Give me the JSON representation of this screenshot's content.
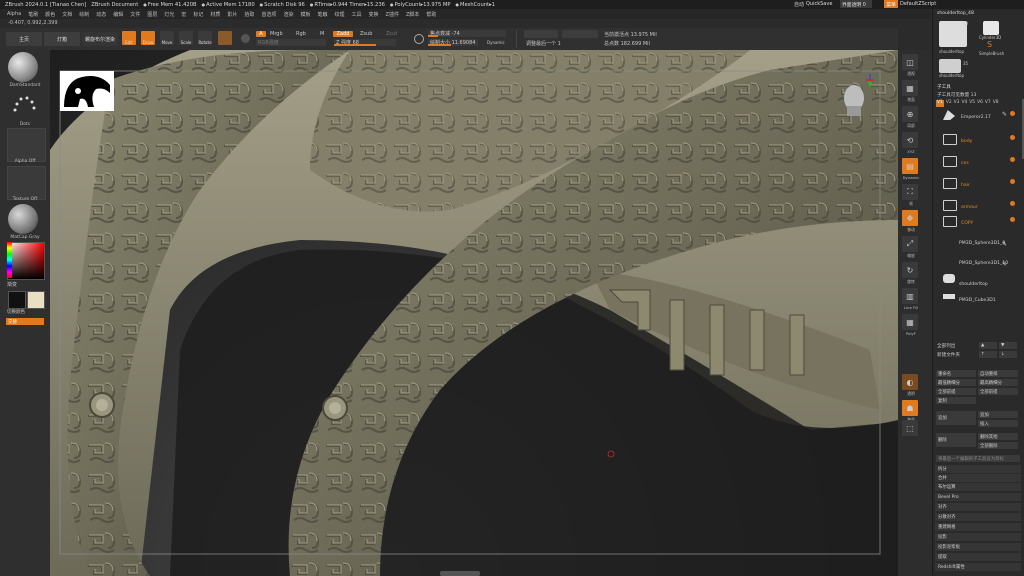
{
  "titlebar": {
    "items": [
      "ZBrush 2024.0.1 [Tianao Chen]",
      "ZBrush Document",
      "Free Mem 41.420B",
      "Active Mem 17180",
      "Scratch Disk 96",
      "RTime▸0.944 Timer▸15.236",
      "PolyCount▸13.975 MP",
      "MeshCount▸1"
    ],
    "quicksave": "QuickSave",
    "autosave": "自动",
    "transparency": "界面透明 0",
    "menu_label": "菜单",
    "script": "DefaultZScript"
  },
  "menubar": [
    "Alpha",
    "笔刷",
    "颜色",
    "文档",
    "绘制",
    "动态",
    "编辑",
    "文件",
    "图层",
    "灯光",
    "宏",
    "标记",
    "材质",
    "影片",
    "拾取",
    "首选项",
    "渲染",
    "模板",
    "笔触",
    "纹理",
    "工具",
    "变换",
    "Z插件",
    "Z脚本",
    "帮助"
  ],
  "coords": "-0.407, 0.992,2.399",
  "toolbar": {
    "home": "主页",
    "lightbox": "灯箱",
    "live_boolean": "螺旋布尔渲染",
    "edit": "Edit",
    "draw": "Draw",
    "move": "Move",
    "scale": "Scale",
    "rotate": "Rotate",
    "a_label": "A",
    "mrgb": "Mrgb",
    "rgb": "Rgb",
    "m": "M",
    "zadd": "Zadd",
    "zsub": "Zsub",
    "zcut": "Zcut",
    "rgb_intensity": "RGB强度",
    "z_intensity": "Z 强度 68",
    "focal_shift": "焦点衰减 -74",
    "draw_size": "绘制大小 11.69084",
    "dynamic": "Dynamic",
    "active_points": "当前激活点 13.975 Mil",
    "total_points": "总点数 182.699 Mil",
    "adjust_last": "调整最后一个 1",
    "draw_size_value": 11.69084,
    "z_intensity_value": 68,
    "focal_shift_value": -74
  },
  "leftshelf": {
    "brush": "DamStandard",
    "stroke": "Dots",
    "alpha": "Alpha Off",
    "texture": "Texture Off",
    "material": "MatCap Gray",
    "gradient": "渐变",
    "switch_color": "切换颜色",
    "alternate": "交替"
  },
  "righttray": [
    "透视",
    "地面",
    "局部",
    "XYZ",
    "Dynamic",
    "帧",
    "移动",
    "缩放",
    "旋转",
    "Line Fill",
    "PolyF",
    "透明",
    "独显"
  ],
  "panel": {
    "tool_name": "shoulderltop_48",
    "thumb1_label": "shoulderltop",
    "thumb1_count": "73",
    "thumb2_label": "Cylinder3D",
    "thumb3_label": "SimpleBrush",
    "thumb4_label": "shoulderltop",
    "thumb4_count": "35",
    "section_title": "子工具",
    "visible_count": "子工具可见数量 13",
    "tabs": [
      "V1",
      "V2",
      "V3",
      "V4",
      "V5",
      "V6",
      "V7",
      "V8"
    ],
    "subtools": [
      {
        "name": "Emperor2.17",
        "type": "mesh"
      },
      {
        "name": "body",
        "type": "folder"
      },
      {
        "name": "cos",
        "type": "folder"
      },
      {
        "name": "hair",
        "type": "folder"
      },
      {
        "name": "armour",
        "type": "folder"
      },
      {
        "name": "COPY",
        "type": "folder"
      },
      {
        "name": "PM3D_Sphere3D1_9",
        "type": "mesh"
      },
      {
        "name": "PM3D_Sphere3D1_10",
        "type": "mesh"
      },
      {
        "name": "shoulderltop",
        "type": "mesh"
      },
      {
        "name": "PM3D_Cube3D1",
        "type": "mesh"
      }
    ],
    "list_all": "全部列出",
    "new_folder": "新建文件夹",
    "rename": "重命名",
    "auto_reorder": "自动重排",
    "all_low": "最低精细分",
    "all_high": "最高精细分",
    "copy": "复制",
    "duplicate": "全部前提",
    "mirror_all": "全部前提",
    "append": "追加",
    "insert": "插入",
    "delete": "删除",
    "delete_other": "删除其他",
    "delete_all": "全部删除",
    "hint": "将最后一个编辑的子工具设为目标",
    "menu_items": [
      "拆分",
      "合并",
      "布尔运算",
      "Bevel Pro",
      "对齐",
      "分散对齐",
      "重建网格",
      "投影",
      "投影泥浆板",
      "提取",
      "Redshift属性"
    ]
  }
}
